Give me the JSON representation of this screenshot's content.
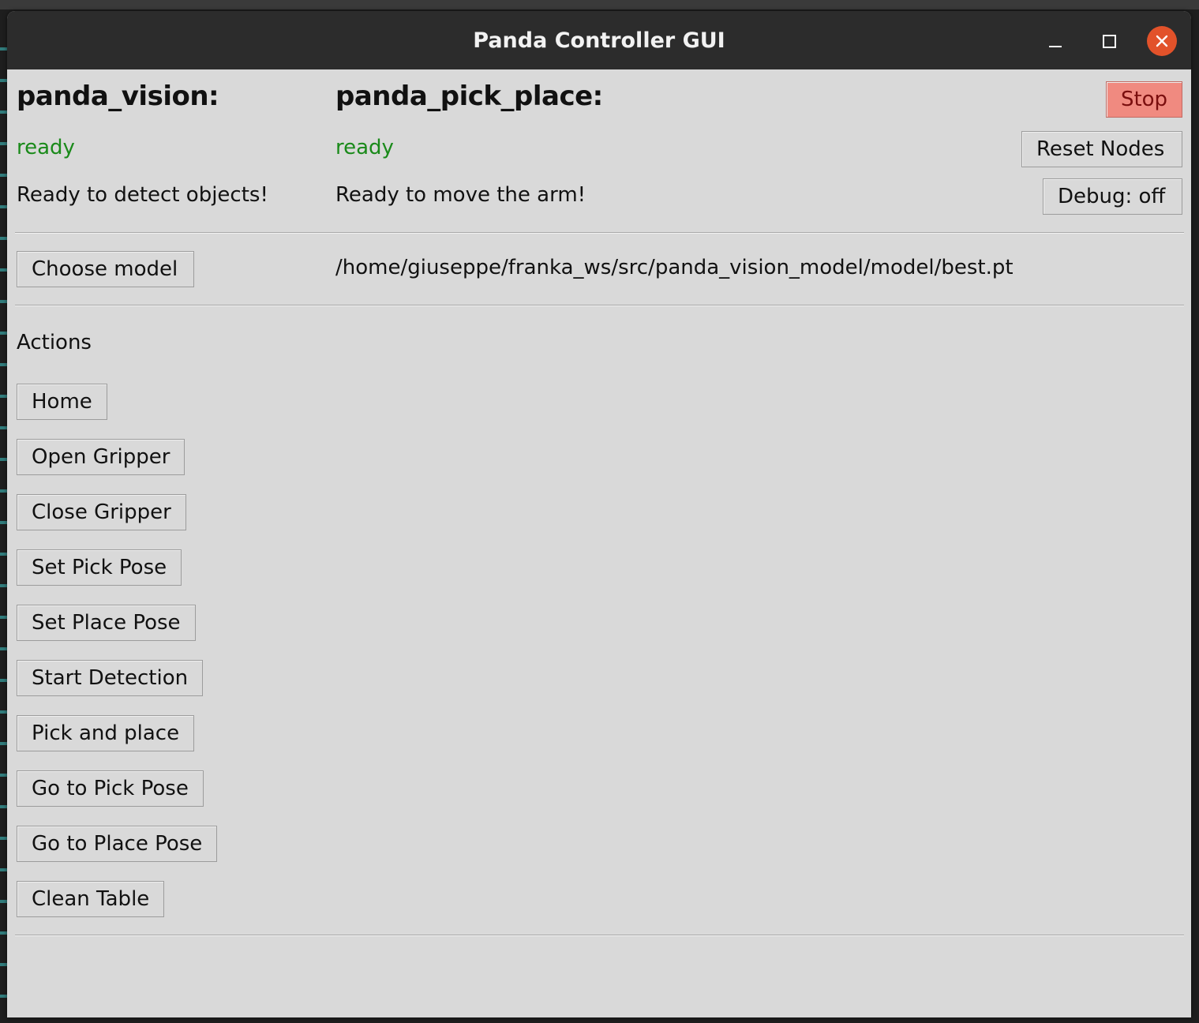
{
  "window": {
    "title": "Panda Controller GUI",
    "controls": {
      "minimize_icon": "minimize-icon",
      "maximize_icon": "maximize-icon",
      "close_icon": "close-icon",
      "close_color": "#e2522a"
    }
  },
  "nodes": {
    "vision": {
      "name": "panda_vision:",
      "status": "ready",
      "message": "Ready to detect objects!"
    },
    "pick_place": {
      "name": "panda_pick_place:",
      "status": "ready",
      "message": "Ready to move the arm!"
    },
    "status_color": "#1a8a1a"
  },
  "controls": {
    "stop_label": "Stop",
    "stop_color": "#f08a80",
    "reset_label": "Reset Nodes",
    "debug_label": "Debug: off"
  },
  "model": {
    "choose_label": "Choose model",
    "path": "/home/giuseppe/franka_ws/src/panda_vision_model/model/best.pt"
  },
  "actions": {
    "heading": "Actions",
    "buttons": [
      {
        "label": "Home"
      },
      {
        "label": "Open Gripper"
      },
      {
        "label": "Close Gripper"
      },
      {
        "label": "Set Pick Pose"
      },
      {
        "label": "Set Place Pose"
      },
      {
        "label": "Start Detection"
      },
      {
        "label": "Pick and place"
      },
      {
        "label": "Go to Pick Pose"
      },
      {
        "label": "Go to Place Pose"
      },
      {
        "label": "Clean Table"
      }
    ]
  }
}
